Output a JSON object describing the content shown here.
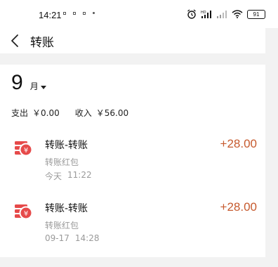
{
  "status_bar": {
    "time": "14:21",
    "battery": "91"
  },
  "header": {
    "title": "转账"
  },
  "month_selector": {
    "month": "9",
    "unit": "月"
  },
  "summary": {
    "expense_label": "支出",
    "expense_value": "￥0.00",
    "income_label": "收入",
    "income_value": "￥56.00"
  },
  "transactions": [
    {
      "title": "转账-转账",
      "subtitle": "转账红包",
      "date": "今天",
      "time": "11:22",
      "amount": "+28.00"
    },
    {
      "title": "转账-转账",
      "subtitle": "转账红包",
      "date": "09-17",
      "time": "14:28",
      "amount": "+28.00"
    }
  ],
  "colors": {
    "amount": "#c65a2e",
    "icon_red": "#e64a4a"
  }
}
